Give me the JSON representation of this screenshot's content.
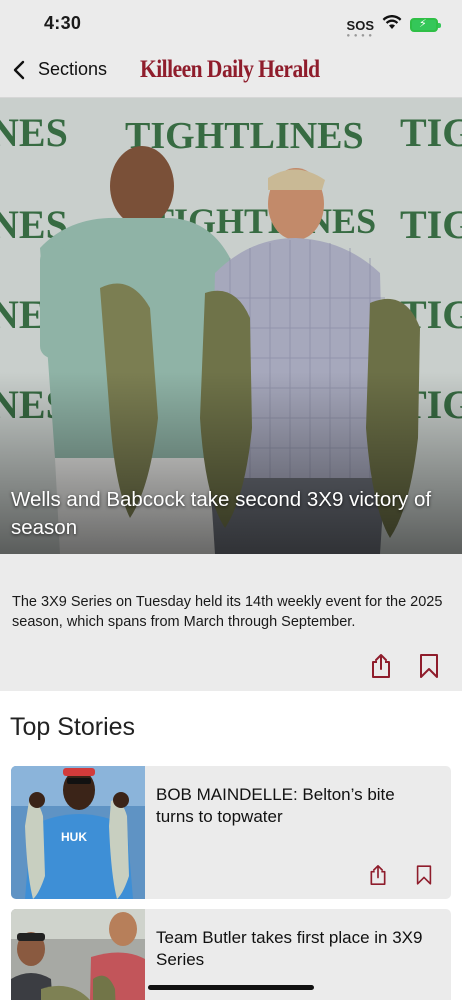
{
  "status_bar": {
    "time": "4:30",
    "sos": "SOS",
    "icons": [
      "wifi-icon",
      "battery-charging-icon"
    ],
    "battery_color": "#34c759"
  },
  "nav": {
    "back_label": "Sections",
    "back_icon": "chevron-left-icon",
    "logo_text": "Killeen Daily Herald",
    "brand_color": "#8f1d2c"
  },
  "hero": {
    "title": "Wells and Babcock take second 3X9 victory of season",
    "summary": "The 3X9 Series on Tuesday held its 14th weekly event for the 2025 season, which spans from March through September.",
    "share_icon": "share-icon",
    "bookmark_icon": "bookmark-icon"
  },
  "top_stories": {
    "heading": "Top Stories",
    "items": [
      {
        "title": "BOB MAINDELLE: Belton’s bite turns to topwater"
      },
      {
        "title": "Team Butler takes first place in 3X9 Series"
      }
    ]
  },
  "colors": {
    "accent": "#8f1d2c",
    "background": "#ebebeb",
    "card": "#ebebeb"
  }
}
